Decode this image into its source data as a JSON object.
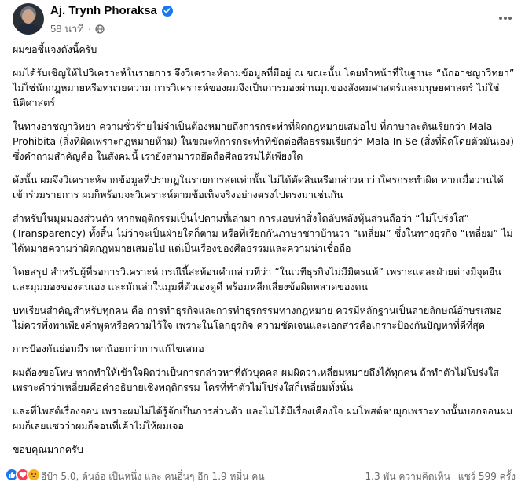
{
  "post": {
    "author": "Aj. Trynh Phoraksa",
    "timestamp": "58 นาที",
    "separator": "·",
    "paragraphs": [
      "ผมขอชี้แจงดังนี้ครับ",
      "ผมได้รับเชิญให้ไปวิเคราะห์ในรายการ จึงวิเคราะห์ตามข้อมูลที่มีอยู่ ณ ขณะนั้น โดยทำหน้าที่ในฐานะ “นักอาชญาวิทยา” ไม่ใช่นักกฎหมายหรือทนายความ การวิเคราะห์ของผมจึงเป็นการมองผ่านมุมของสังคมศาสตร์และมนุษยศาสตร์ ไม่ใช่นิติศาสตร์",
      "ในทางอาชญาวิทยา ความชั่วร้ายไม่จำเป็นต้องหมายถึงการกระทำที่ผิดกฎหมายเสมอไป ที่ภาษาละตินเรียกว่า Mala Prohibita (สิ่งที่ผิดเพราะกฎหมายห้าม) ในขณะที่การกระทำที่ขัดต่อศีลธรรมเรียกว่า Mala In Se (สิ่งที่ผิดโดยตัวมันเอง) ซึ่งคำถามสำคัญคือ ในสังคมนี้ เรายังสามารถยึดถือศีลธรรมได้เพียงใด",
      "ดังนั้น ผมจึงวิเคราะห์จากข้อมูลที่ปรากฏในรายการสดเท่านั้น ไม่ได้ตัดสินหรือกล่าวหาว่าใครกระทำผิด หากเมื่อวานได้เข้าร่วมรายการ ผมก็พร้อมจะวิเคราะห์ตามข้อเท็จจริงอย่างตรงไปตรงมาเช่นกัน",
      "สำหรับในมุมมองส่วนตัว หากพฤติกรรมเป็นไปตามที่เล่ามา การแอบทำสิ่งใดลับหลังหุ้นส่วนถือว่า “ไม่โปร่งใส” (Transparency) ทั้งสิ้น ไม่ว่าจะเป็นฝ่ายใดก็ตาม หรือที่เรียกกันภาษาชาวบ้านว่า “เหลี่ยม” ซึ่งในทางธุรกิจ “เหลี่ยม” ไม่ได้หมายความว่าผิดกฎหมายเสมอไป แต่เป็นเรื่องของศีลธรรมและความน่าเชื่อถือ",
      "โดยสรุป สำหรับผู้ที่รอการวิเคราะห์ กรณีนี้สะท้อนคำกล่าวที่ว่า “ในเวทีธุรกิจไม่มีมิตรแท้” เพราะแต่ละฝ่ายต่างมีจุดยืนและมุมมองของตนเอง และมักเล่าในมุมที่ตัวเองดูดี พร้อมหลีกเลี่ยงข้อผิดพลาดของตน",
      "บทเรียนสำคัญสำหรับทุกคน คือ การทำธุรกิจและการทำธุรกรรมทางกฎหมาย ควรมีหลักฐานเป็นลายลักษณ์อักษรเสมอ ไม่ควรพึ่งพาเพียงคำพูดหรือความไว้ใจ เพราะในโลกธุรกิจ ความชัดเจนและเอกสารคือเกราะป้องกันปัญหาที่ดีที่สุด",
      "การป้องกันย่อมมีราคาน้อยกว่าการแก้ไขเสมอ",
      "ผมต้องขอโทษ หากทำให้เข้าใจผิดว่าเป็นการกล่าวหาที่ตัวบุคคล  ผมผิดว่าเหลี่ยมหมายถึงได้ทุกคน ถ้าทำตัวไม่โปร่งใส เพราะคำว่าเหลี่ยมคือคำอธิบายเชิงพฤติกรรม ใครที่ทำตัวไม่โปร่งใสก็เหลี่ยมทั้งนั้น",
      "และที่โพสต์เรื่องจอน เพราะผมไม่ได้รู้จักเป็นการส่วนตัว และไม่ได้มีเรื่องเคืองใจ ผมโพสต์ตบมุกเพราะทางนั้นบอกจอนผม ผมก็เลยแซวว่าผมก็จอนที่เค้าไม่ให้ผมเจอ",
      "ขอบคุณมากครับ"
    ]
  },
  "footer": {
    "reaction_summary": "อีป้า 5.0, ต้นอ้อ เป็นหนึ่ง และ คนอื่นๆ อีก 1.9 หมื่น คน",
    "comments": "1.3 พัน ความคิดเห็น",
    "shares": "แชร์ 599 ครั้ง"
  },
  "icons": {
    "verified": "verified-badge-icon",
    "audience": "globe-icon",
    "more": "more-options-icon",
    "reactions": [
      "like-icon",
      "love-icon",
      "haha-icon"
    ]
  },
  "colors": {
    "accent": "#1877f2",
    "text": "#050505",
    "secondary_text": "#65676b",
    "love": "#f33e58",
    "haha": "#f7b125"
  }
}
